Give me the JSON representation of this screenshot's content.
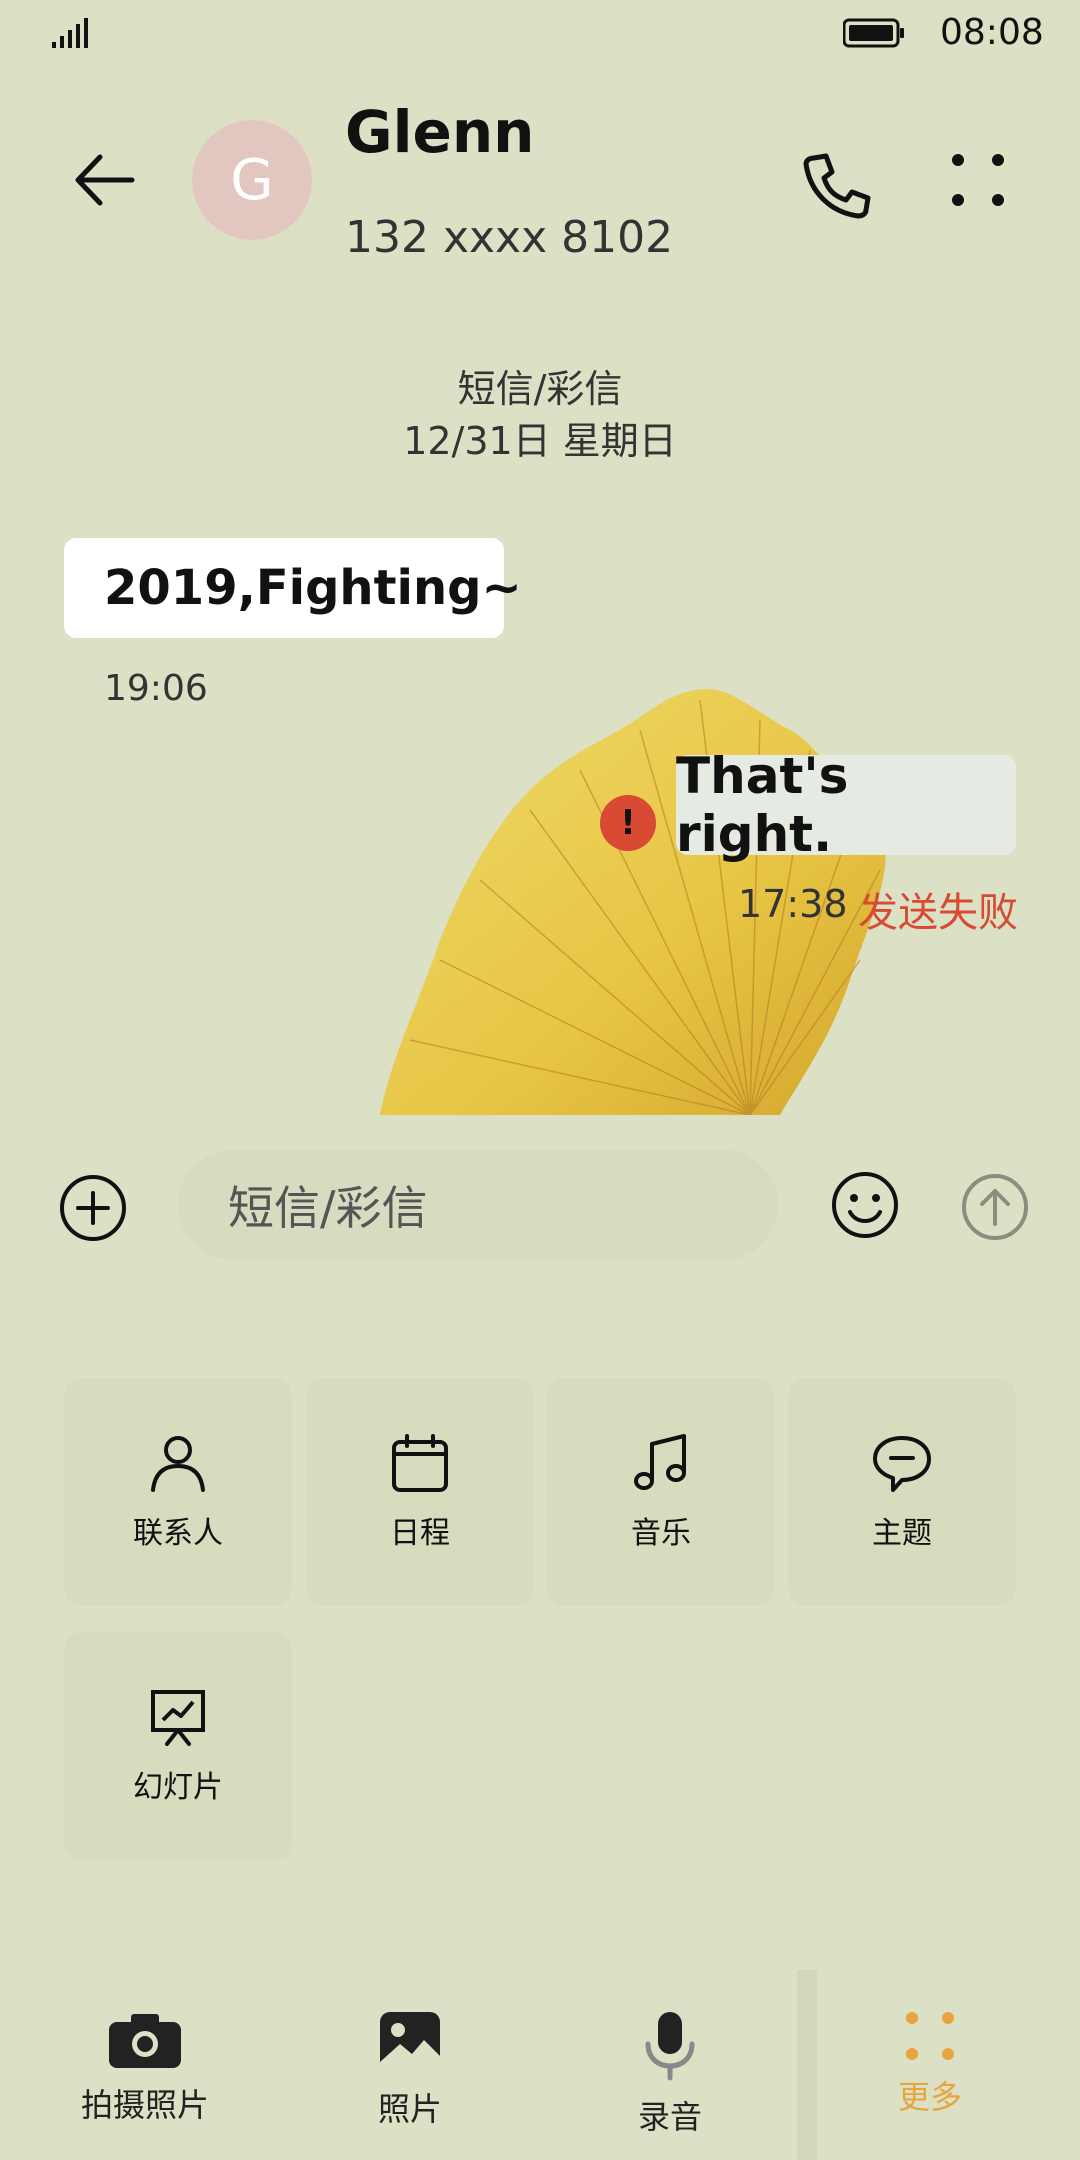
{
  "status_bar": {
    "time": "08:08"
  },
  "header": {
    "avatar_letter": "G",
    "contact_name": "Glenn",
    "contact_number": "132 xxxx 8102"
  },
  "conversation": {
    "type_label": "短信/彩信",
    "date_label": "12/31日 星期日"
  },
  "messages": [
    {
      "direction": "incoming",
      "text": "2019,Fighting~",
      "time": "19:06"
    },
    {
      "direction": "outgoing",
      "text": "That's right.",
      "time": "17:38",
      "status": "发送失败",
      "error_icon": "!"
    }
  ],
  "input": {
    "placeholder": "短信/彩信"
  },
  "attachments": [
    {
      "label": "联系人",
      "icon": "person-icon"
    },
    {
      "label": "日程",
      "icon": "calendar-icon"
    },
    {
      "label": "音乐",
      "icon": "music-icon"
    },
    {
      "label": "主题",
      "icon": "chat-bubble-icon"
    },
    {
      "label": "幻灯片",
      "icon": "slideshow-icon"
    }
  ],
  "bottom_bar": [
    {
      "label": "拍摄照片",
      "icon": "camera-icon"
    },
    {
      "label": "照片",
      "icon": "image-icon"
    },
    {
      "label": "录音",
      "icon": "microphone-icon"
    },
    {
      "label": "更多",
      "icon": "more-dots-icon",
      "active": true
    }
  ],
  "colors": {
    "background": "#dce0c4",
    "error": "#d84a34",
    "accent": "#e8a43f",
    "avatar": "#e2c7c1"
  }
}
